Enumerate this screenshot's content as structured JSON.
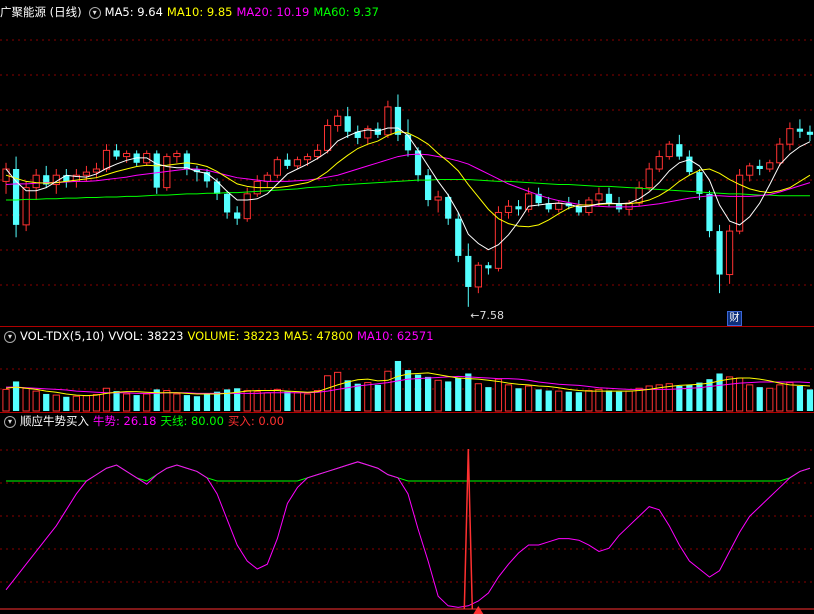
{
  "main_panel": {
    "title": "广聚能源 (日线)",
    "legend": [
      {
        "label": "MA5: 9.64",
        "color": "#ffffff"
      },
      {
        "label": "MA10: 9.85",
        "color": "#ffff00"
      },
      {
        "label": "MA20: 10.19",
        "color": "#ff00ff"
      },
      {
        "label": "MA60: 9.37",
        "color": "#00ff00"
      }
    ],
    "low_annotation": "←7.58",
    "badge": "财"
  },
  "volume_panel": {
    "title": "VOL-TDX(5,10)",
    "legend": [
      {
        "label": "VVOL: 38223",
        "color": "#ffffff"
      },
      {
        "label": "VOLUME: 38223",
        "color": "#ffff00"
      },
      {
        "label": "MA5: 47800",
        "color": "#ffff00"
      },
      {
        "label": "MA10: 62571",
        "color": "#ff00ff"
      }
    ]
  },
  "indicator_panel": {
    "title": "顺应牛势买入",
    "legend": [
      {
        "label": "牛势: 26.18",
        "color": "#ff00ff"
      },
      {
        "label": "天线: 80.00",
        "color": "#00ff00"
      },
      {
        "label": "买入: 0.00",
        "color": "#ff3030"
      }
    ]
  },
  "colors": {
    "up": "#ff3232",
    "down": "#54ffff",
    "grid": "#8a0000",
    "ma5": "#ffffff",
    "ma10": "#ffff00",
    "ma20": "#ff00ff",
    "ma60": "#00ff00"
  },
  "chart_data": {
    "type": "candlestick",
    "price_range": [
      7.4,
      12.2
    ],
    "ohlc": [
      [
        9.6,
        9.9,
        9.4,
        9.8
      ],
      [
        9.8,
        10.0,
        8.7,
        8.9
      ],
      [
        8.9,
        9.6,
        8.8,
        9.5
      ],
      [
        9.5,
        9.8,
        9.3,
        9.7
      ],
      [
        9.7,
        9.85,
        9.5,
        9.55
      ],
      [
        9.55,
        9.8,
        9.4,
        9.7
      ],
      [
        9.7,
        9.8,
        9.5,
        9.6
      ],
      [
        9.6,
        9.8,
        9.5,
        9.7
      ],
      [
        9.7,
        9.85,
        9.6,
        9.75
      ],
      [
        9.75,
        9.9,
        9.65,
        9.8
      ],
      [
        9.8,
        10.2,
        9.75,
        10.1
      ],
      [
        10.1,
        10.2,
        9.95,
        10.0
      ],
      [
        10.0,
        10.1,
        9.9,
        10.05
      ],
      [
        10.05,
        10.1,
        9.85,
        9.9
      ],
      [
        9.9,
        10.1,
        9.85,
        10.05
      ],
      [
        10.05,
        10.1,
        9.4,
        9.5
      ],
      [
        9.5,
        10.05,
        9.45,
        10.0
      ],
      [
        10.0,
        10.1,
        9.9,
        10.05
      ],
      [
        10.05,
        10.1,
        9.7,
        9.8
      ],
      [
        9.8,
        9.85,
        9.6,
        9.75
      ],
      [
        9.75,
        9.8,
        9.5,
        9.6
      ],
      [
        9.6,
        9.65,
        9.3,
        9.4
      ],
      [
        9.4,
        9.45,
        9.0,
        9.1
      ],
      [
        9.1,
        9.2,
        8.9,
        9.0
      ],
      [
        9.0,
        9.5,
        8.95,
        9.4
      ],
      [
        9.4,
        9.7,
        9.35,
        9.6
      ],
      [
        9.6,
        9.75,
        9.5,
        9.7
      ],
      [
        9.7,
        10.0,
        9.65,
        9.95
      ],
      [
        9.95,
        10.05,
        9.8,
        9.85
      ],
      [
        9.85,
        10.0,
        9.8,
        9.95
      ],
      [
        9.95,
        10.05,
        9.85,
        10.0
      ],
      [
        10.0,
        10.2,
        9.95,
        10.1
      ],
      [
        10.1,
        10.6,
        10.05,
        10.5
      ],
      [
        10.5,
        10.75,
        10.4,
        10.65
      ],
      [
        10.65,
        10.8,
        10.3,
        10.4
      ],
      [
        10.4,
        10.5,
        10.2,
        10.3
      ],
      [
        10.3,
        10.5,
        10.2,
        10.45
      ],
      [
        10.45,
        10.55,
        10.3,
        10.35
      ],
      [
        10.35,
        10.9,
        10.3,
        10.8
      ],
      [
        10.8,
        11.0,
        10.25,
        10.35
      ],
      [
        10.35,
        10.6,
        10.0,
        10.1
      ],
      [
        10.1,
        10.15,
        9.6,
        9.7
      ],
      [
        9.7,
        9.8,
        9.2,
        9.3
      ],
      [
        9.3,
        9.45,
        9.1,
        9.35
      ],
      [
        9.35,
        9.4,
        8.9,
        9.0
      ],
      [
        9.0,
        9.1,
        8.3,
        8.4
      ],
      [
        8.4,
        8.6,
        7.58,
        7.9
      ],
      [
        7.9,
        8.3,
        7.8,
        8.25
      ],
      [
        8.25,
        8.3,
        8.1,
        8.2
      ],
      [
        8.2,
        9.2,
        8.15,
        9.1
      ],
      [
        9.1,
        9.3,
        9.0,
        9.2
      ],
      [
        9.2,
        9.3,
        9.05,
        9.15
      ],
      [
        9.15,
        9.5,
        9.1,
        9.4
      ],
      [
        9.4,
        9.5,
        9.2,
        9.25
      ],
      [
        9.25,
        9.35,
        9.1,
        9.15
      ],
      [
        9.15,
        9.3,
        9.1,
        9.25
      ],
      [
        9.25,
        9.35,
        9.15,
        9.2
      ],
      [
        9.2,
        9.3,
        9.05,
        9.1
      ],
      [
        9.1,
        9.35,
        9.05,
        9.3
      ],
      [
        9.3,
        9.5,
        9.2,
        9.4
      ],
      [
        9.4,
        9.5,
        9.2,
        9.25
      ],
      [
        9.25,
        9.35,
        9.1,
        9.15
      ],
      [
        9.15,
        9.3,
        9.05,
        9.25
      ],
      [
        9.25,
        9.6,
        9.2,
        9.5
      ],
      [
        9.5,
        9.9,
        9.45,
        9.8
      ],
      [
        9.8,
        10.1,
        9.75,
        10.0
      ],
      [
        10.0,
        10.25,
        9.95,
        10.2
      ],
      [
        10.2,
        10.35,
        9.95,
        10.0
      ],
      [
        10.0,
        10.1,
        9.7,
        9.75
      ],
      [
        9.75,
        9.8,
        9.3,
        9.4
      ],
      [
        9.4,
        9.45,
        8.7,
        8.8
      ],
      [
        8.8,
        8.9,
        7.8,
        8.1
      ],
      [
        8.1,
        8.9,
        7.95,
        8.8
      ],
      [
        8.8,
        9.8,
        8.75,
        9.7
      ],
      [
        9.7,
        9.9,
        9.6,
        9.85
      ],
      [
        9.85,
        9.95,
        9.7,
        9.8
      ],
      [
        9.8,
        9.95,
        9.75,
        9.9
      ],
      [
        9.9,
        10.3,
        9.85,
        10.2
      ],
      [
        10.2,
        10.55,
        10.1,
        10.45
      ],
      [
        10.45,
        10.6,
        10.3,
        10.4
      ],
      [
        10.4,
        10.5,
        10.25,
        10.35
      ]
    ],
    "ma5": [
      9.8,
      9.6,
      9.45,
      9.45,
      9.5,
      9.6,
      9.7,
      9.68,
      9.67,
      9.72,
      9.81,
      9.88,
      9.94,
      9.98,
      9.98,
      9.88,
      9.84,
      9.82,
      9.82,
      9.76,
      9.73,
      9.6,
      9.44,
      9.3,
      9.3,
      9.32,
      9.4,
      9.56,
      9.72,
      9.8,
      9.88,
      9.97,
      10.08,
      10.25,
      10.33,
      10.4,
      10.43,
      10.41,
      10.46,
      10.46,
      10.34,
      10.1,
      9.85,
      9.6,
      9.38,
      9.1,
      8.75,
      8.6,
      8.5,
      8.58,
      8.74,
      8.95,
      9.2,
      9.22,
      9.24,
      9.25,
      9.23,
      9.19,
      9.2,
      9.24,
      9.25,
      9.24,
      9.25,
      9.32,
      9.43,
      9.58,
      9.77,
      9.9,
      9.95,
      9.85,
      9.62,
      9.22,
      8.96,
      8.9,
      9.03,
      9.25,
      9.55,
      9.87,
      10.04,
      10.16,
      10.24
    ],
    "ma10": [
      9.7,
      9.65,
      9.6,
      9.58,
      9.57,
      9.58,
      9.6,
      9.62,
      9.64,
      9.66,
      9.71,
      9.76,
      9.8,
      9.84,
      9.86,
      9.85,
      9.86,
      9.88,
      9.9,
      9.88,
      9.84,
      9.76,
      9.66,
      9.56,
      9.52,
      9.5,
      9.5,
      9.5,
      9.52,
      9.55,
      9.58,
      9.65,
      9.76,
      9.9,
      10.02,
      10.13,
      10.2,
      10.25,
      10.34,
      10.4,
      10.38,
      10.3,
      10.2,
      10.05,
      9.92,
      9.77,
      9.55,
      9.35,
      9.15,
      9.0,
      8.92,
      8.88,
      8.87,
      8.9,
      8.98,
      9.08,
      9.17,
      9.22,
      9.22,
      9.23,
      9.24,
      9.24,
      9.24,
      9.26,
      9.3,
      9.37,
      9.47,
      9.6,
      9.7,
      9.78,
      9.8,
      9.73,
      9.63,
      9.55,
      9.48,
      9.44,
      9.42,
      9.45,
      9.5,
      9.6,
      9.7
    ],
    "ma20": [
      9.55,
      9.56,
      9.56,
      9.57,
      9.58,
      9.58,
      9.59,
      9.6,
      9.6,
      9.61,
      9.63,
      9.65,
      9.67,
      9.7,
      9.72,
      9.74,
      9.76,
      9.78,
      9.8,
      9.8,
      9.78,
      9.74,
      9.7,
      9.66,
      9.64,
      9.62,
      9.6,
      9.6,
      9.6,
      9.61,
      9.62,
      9.64,
      9.67,
      9.7,
      9.75,
      9.8,
      9.85,
      9.9,
      9.95,
      10.0,
      10.03,
      10.04,
      10.03,
      10.0,
      9.97,
      9.93,
      9.88,
      9.8,
      9.72,
      9.64,
      9.56,
      9.5,
      9.44,
      9.38,
      9.33,
      9.29,
      9.26,
      9.23,
      9.21,
      9.2,
      9.19,
      9.19,
      9.19,
      9.2,
      9.22,
      9.24,
      9.27,
      9.3,
      9.33,
      9.35,
      9.37,
      9.37,
      9.36,
      9.36,
      9.36,
      9.37,
      9.39,
      9.43,
      9.48,
      9.53,
      9.58
    ],
    "ma60": [
      9.3,
      9.3,
      9.31,
      9.31,
      9.32,
      9.32,
      9.33,
      9.33,
      9.34,
      9.34,
      9.35,
      9.35,
      9.36,
      9.36,
      9.37,
      9.38,
      9.38,
      9.39,
      9.4,
      9.4,
      9.41,
      9.41,
      9.42,
      9.42,
      9.43,
      9.44,
      9.45,
      9.46,
      9.47,
      9.48,
      9.5,
      9.51,
      9.52,
      9.54,
      9.55,
      9.56,
      9.57,
      9.58,
      9.59,
      9.6,
      9.61,
      9.62,
      9.62,
      9.63,
      9.63,
      9.63,
      9.63,
      9.62,
      9.61,
      9.6,
      9.6,
      9.59,
      9.58,
      9.57,
      9.56,
      9.55,
      9.55,
      9.54,
      9.53,
      9.52,
      9.52,
      9.51,
      9.5,
      9.49,
      9.48,
      9.47,
      9.46,
      9.45,
      9.44,
      9.43,
      9.42,
      9.41,
      9.4,
      9.4,
      9.39,
      9.38,
      9.38,
      9.37,
      9.37,
      9.37,
      9.37
    ],
    "volume": [
      38,
      52,
      40,
      35,
      30,
      28,
      25,
      26,
      27,
      29,
      40,
      35,
      30,
      28,
      30,
      38,
      36,
      30,
      28,
      26,
      30,
      34,
      38,
      40,
      36,
      34,
      32,
      38,
      34,
      32,
      30,
      36,
      62,
      68,
      54,
      48,
      50,
      46,
      70,
      88,
      72,
      64,
      60,
      54,
      52,
      58,
      66,
      48,
      42,
      56,
      46,
      40,
      44,
      38,
      36,
      35,
      34,
      33,
      36,
      38,
      36,
      34,
      35,
      40,
      44,
      46,
      48,
      44,
      46,
      50,
      56,
      66,
      60,
      58,
      46,
      42,
      40,
      46,
      50,
      44,
      38
    ],
    "vol_ma5": [
      40,
      42,
      40,
      38,
      35,
      33,
      30,
      28,
      27,
      28,
      31,
      33,
      34,
      34,
      33,
      32,
      32,
      32,
      31,
      30,
      30,
      30,
      31,
      33,
      35,
      36,
      36,
      36,
      35,
      34,
      33,
      34,
      40,
      46,
      51,
      55,
      56,
      53,
      54,
      61,
      65,
      66,
      67,
      64,
      61,
      58,
      57,
      56,
      54,
      52,
      49,
      47,
      46,
      44,
      43,
      41,
      38,
      36,
      35,
      35,
      35,
      35,
      35,
      36,
      38,
      41,
      43,
      45,
      46,
      47,
      49,
      53,
      56,
      58,
      58,
      56,
      53,
      49,
      46,
      45,
      44
    ],
    "vol_ma10": [
      42,
      42,
      41,
      40,
      39,
      38,
      37,
      35,
      34,
      33,
      32,
      32,
      32,
      31,
      31,
      31,
      32,
      32,
      32,
      31,
      31,
      31,
      31,
      31,
      31,
      31,
      32,
      32,
      32,
      32,
      32,
      33,
      35,
      38,
      41,
      44,
      46,
      48,
      50,
      53,
      56,
      57,
      58,
      59,
      60,
      61,
      60,
      59,
      58,
      57,
      57,
      56,
      54,
      51,
      49,
      47,
      46,
      45,
      43,
      41,
      40,
      39,
      38,
      38,
      38,
      38,
      38,
      39,
      40,
      41,
      43,
      45,
      47,
      49,
      50,
      51,
      51,
      51,
      51,
      51,
      50
    ],
    "bull": [
      12,
      20,
      28,
      36,
      44,
      52,
      62,
      72,
      80,
      84,
      88,
      90,
      86,
      82,
      78,
      84,
      88,
      90,
      88,
      86,
      82,
      72,
      56,
      40,
      30,
      25,
      28,
      44,
      66,
      76,
      82,
      84,
      86,
      88,
      90,
      92,
      90,
      88,
      84,
      82,
      72,
      50,
      30,
      8,
      2,
      1,
      2,
      5,
      10,
      20,
      28,
      35,
      40,
      40,
      42,
      44,
      44,
      43,
      40,
      36,
      38,
      46,
      52,
      58,
      64,
      62,
      52,
      40,
      30,
      25,
      20,
      24,
      36,
      48,
      58,
      64,
      70,
      76,
      82,
      86,
      88
    ],
    "antenna": 80,
    "buy_signal_index": 46,
    "buy_signal_value": 100
  }
}
